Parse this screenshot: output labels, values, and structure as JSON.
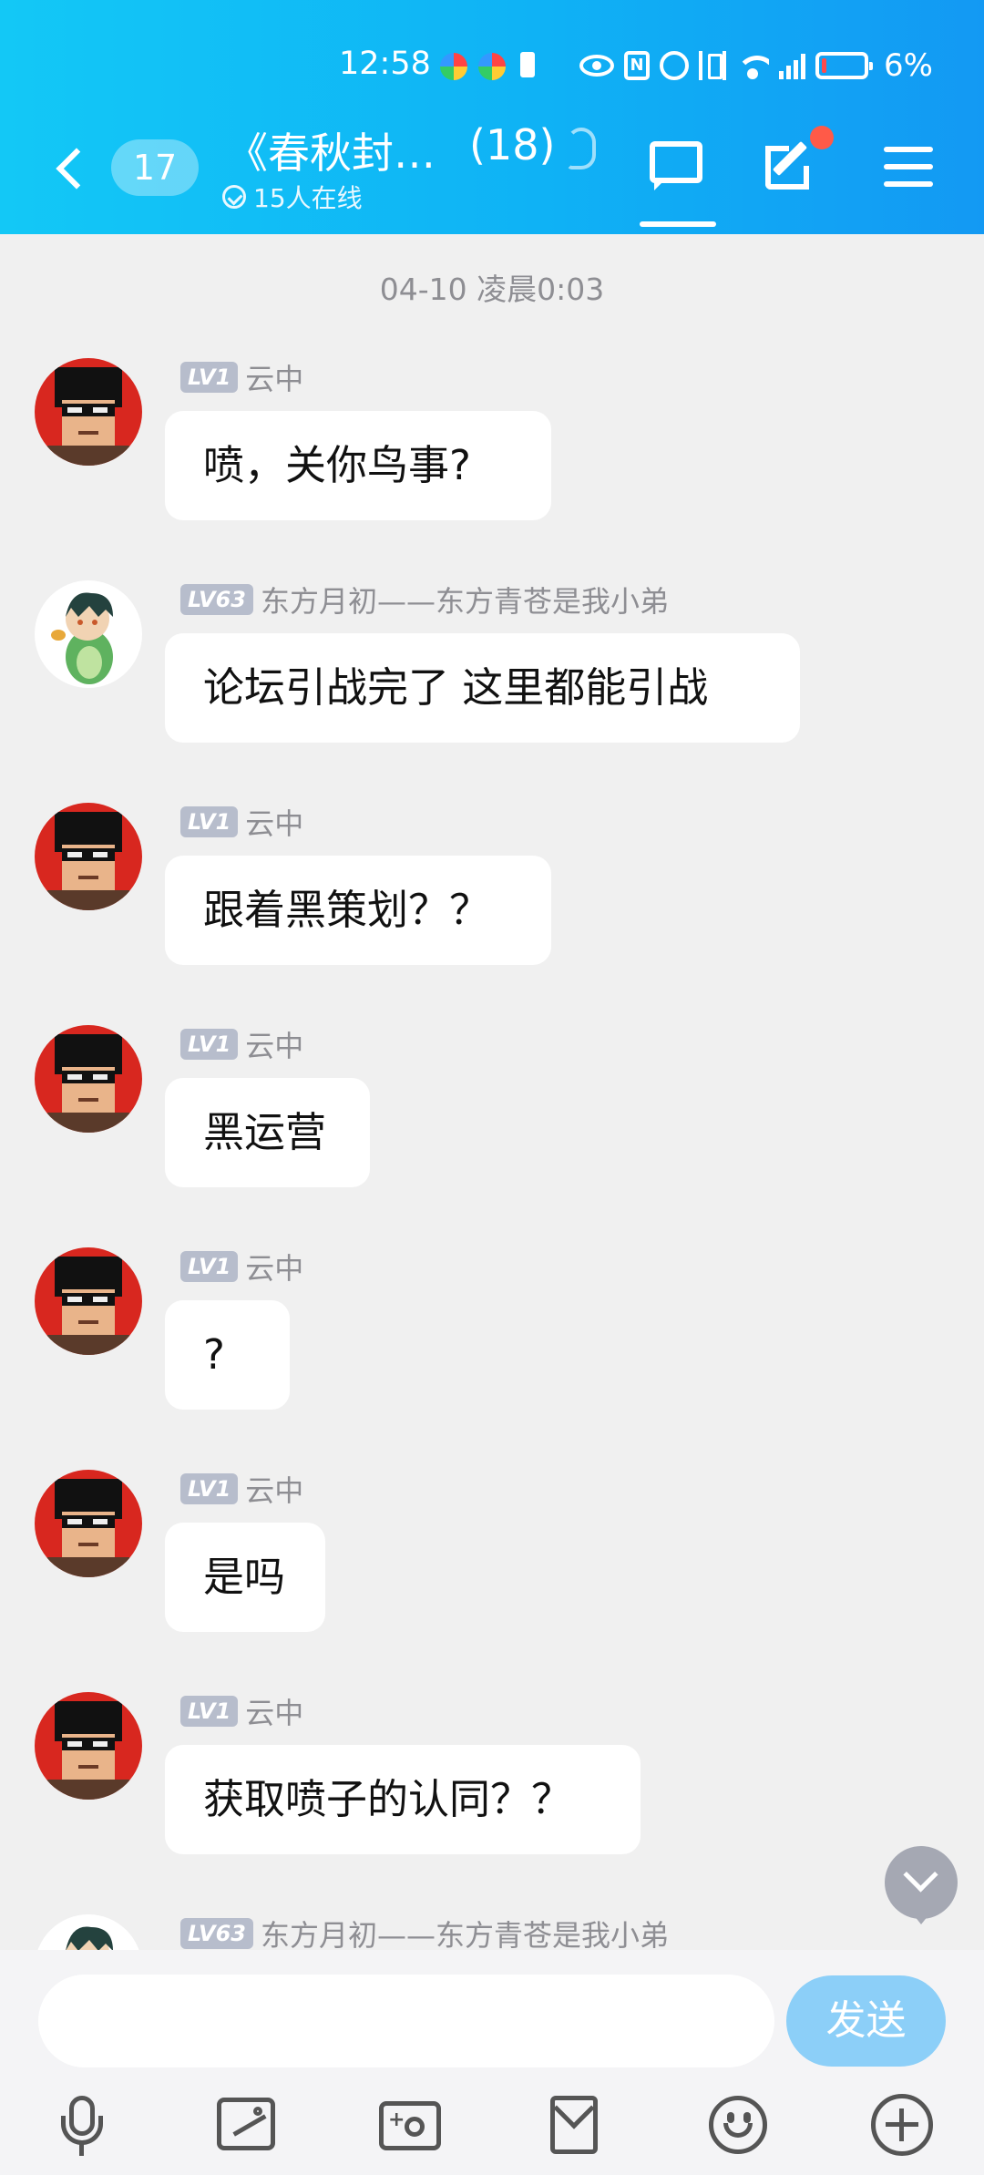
{
  "status_bar": {
    "time": "12:58",
    "battery": "6%"
  },
  "header": {
    "unread_count": "17",
    "group_title": "《春秋封…",
    "member_count": "(18)",
    "online_text": "15人在线"
  },
  "chat": {
    "timestamp": "04-10 凌晨0:03",
    "messages": [
      {
        "level": "LV1",
        "sender": "云中",
        "text": "喷，关你鸟事?",
        "avatar": "pixel-sunglasses"
      },
      {
        "level": "LV63",
        "sender": "东方月初——东方青苍是我小弟",
        "text": "论坛引战完了  这里都能引战",
        "avatar": "anime-dino"
      },
      {
        "level": "LV1",
        "sender": "云中",
        "text": "跟着黑策划？？",
        "avatar": "pixel-sunglasses"
      },
      {
        "level": "LV1",
        "sender": "云中",
        "text": "黑运营",
        "avatar": "pixel-sunglasses"
      },
      {
        "level": "LV1",
        "sender": "云中",
        "text": "?",
        "avatar": "pixel-sunglasses"
      },
      {
        "level": "LV1",
        "sender": "云中",
        "text": "是吗",
        "avatar": "pixel-sunglasses"
      },
      {
        "level": "LV1",
        "sender": "云中",
        "text": "获取喷子的认同？？",
        "avatar": "pixel-sunglasses"
      },
      {
        "level": "LV63",
        "sender": "东方月初——东方青苍是我小弟",
        "text": "",
        "avatar": "anime-dino"
      }
    ]
  },
  "input": {
    "placeholder": "",
    "send_label": "发送"
  },
  "toolbar": {
    "icons": [
      "microphone-icon",
      "image-icon",
      "camera-icon",
      "red-packet-icon",
      "emoji-icon",
      "plus-icon"
    ]
  },
  "colors": {
    "header_gradient_start": "#13c8f6",
    "header_gradient_end": "#1399f3",
    "level_badge": "#b7bdcc",
    "send_button": "#8ccff8",
    "notification_dot": "#ff5a48"
  }
}
